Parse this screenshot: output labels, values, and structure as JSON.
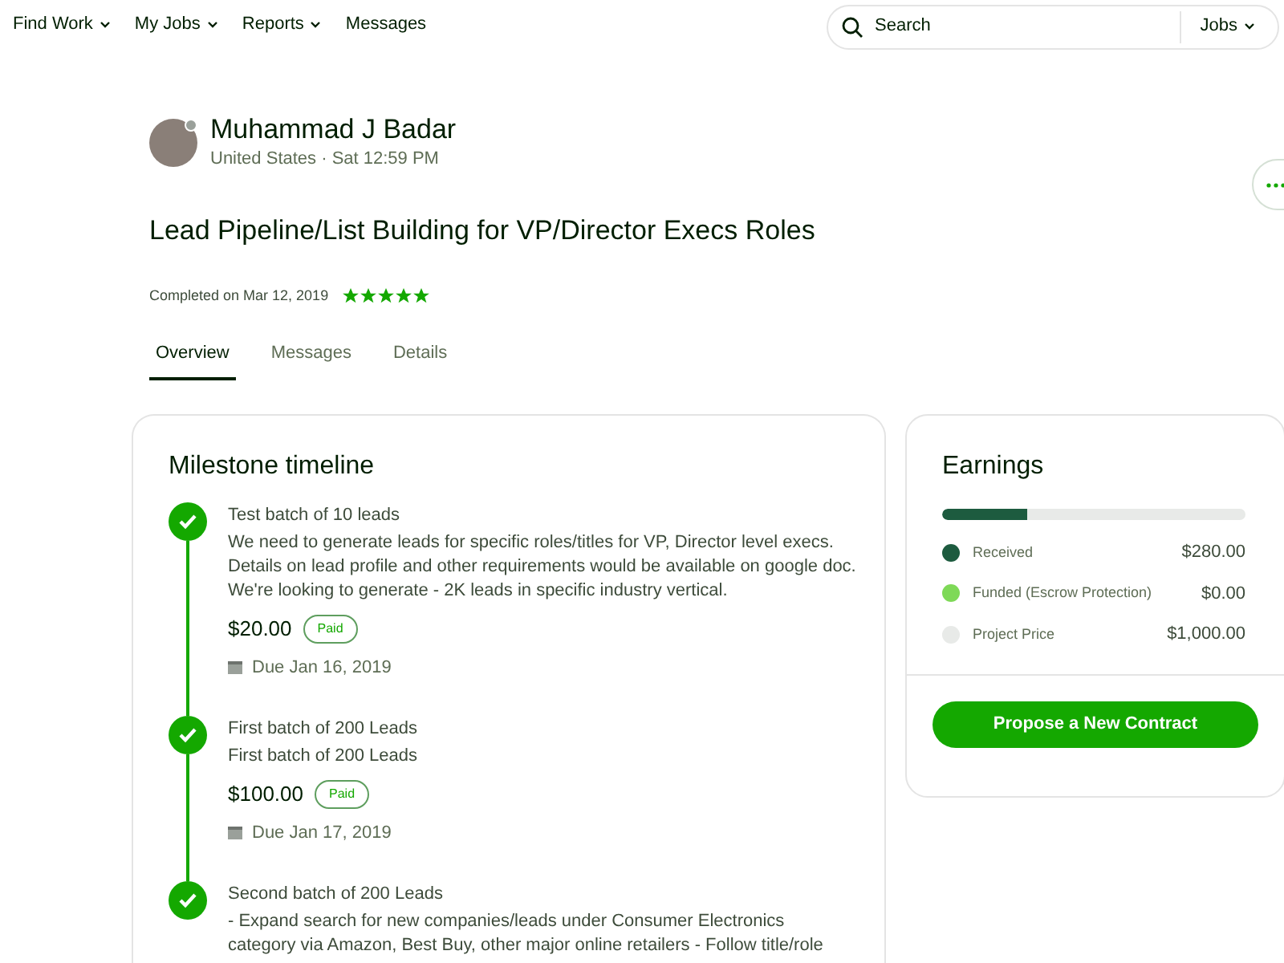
{
  "nav": {
    "items": [
      {
        "label": "Find Work",
        "dropdown": true
      },
      {
        "label": "My Jobs",
        "dropdown": true
      },
      {
        "label": "Reports",
        "dropdown": true
      },
      {
        "label": "Messages",
        "dropdown": false
      }
    ],
    "search": {
      "placeholder": "Search",
      "scope": "Jobs"
    }
  },
  "profile": {
    "name": "Muhammad J Badar",
    "meta": "United States · Sat 12:59 PM"
  },
  "job": {
    "title": "Lead Pipeline/List Building for VP/Director Execs Roles",
    "completed": "Completed on Mar 12, 2019",
    "stars": 5
  },
  "tabs": [
    {
      "label": "Overview",
      "selected": true
    },
    {
      "label": "Messages",
      "selected": false
    },
    {
      "label": "Details",
      "selected": false
    }
  ],
  "milestones": {
    "title": "Milestone timeline",
    "items": [
      {
        "name": "Test batch of 10 leads",
        "description": "We need to generate leads for specific roles/titles for VP, Director level execs.\nDetails on lead profile and other requirements would be available on google doc.\nWe're looking to generate - 2K leads in specific industry vertical.",
        "amount": "$20.00",
        "status": "Paid",
        "due": "Due Jan 16, 2019",
        "done": true
      },
      {
        "name": "First batch of 200 Leads",
        "description": "First batch of 200 Leads",
        "amount": "$100.00",
        "status": "Paid",
        "due": "Due Jan 17, 2019",
        "done": true
      },
      {
        "name": "Second batch of 200 Leads",
        "description": "- Expand search for new companies/leads under Consumer Electronics\ncategory via Amazon, Best Buy, other major online retailers - Follow title/role",
        "done": true
      }
    ]
  },
  "earnings": {
    "title": "Earnings",
    "level": 0.28,
    "legend": [
      {
        "label": "Received",
        "value": "$280.00",
        "color": "#1d5b3f"
      },
      {
        "label": "Funded (Escrow Protection)",
        "value": "$0.00",
        "color": "#7ed957"
      },
      {
        "label": "Project Price",
        "value": "$1,000.00",
        "color": "#e8eae8"
      }
    ],
    "button": "Propose a New Contract"
  }
}
